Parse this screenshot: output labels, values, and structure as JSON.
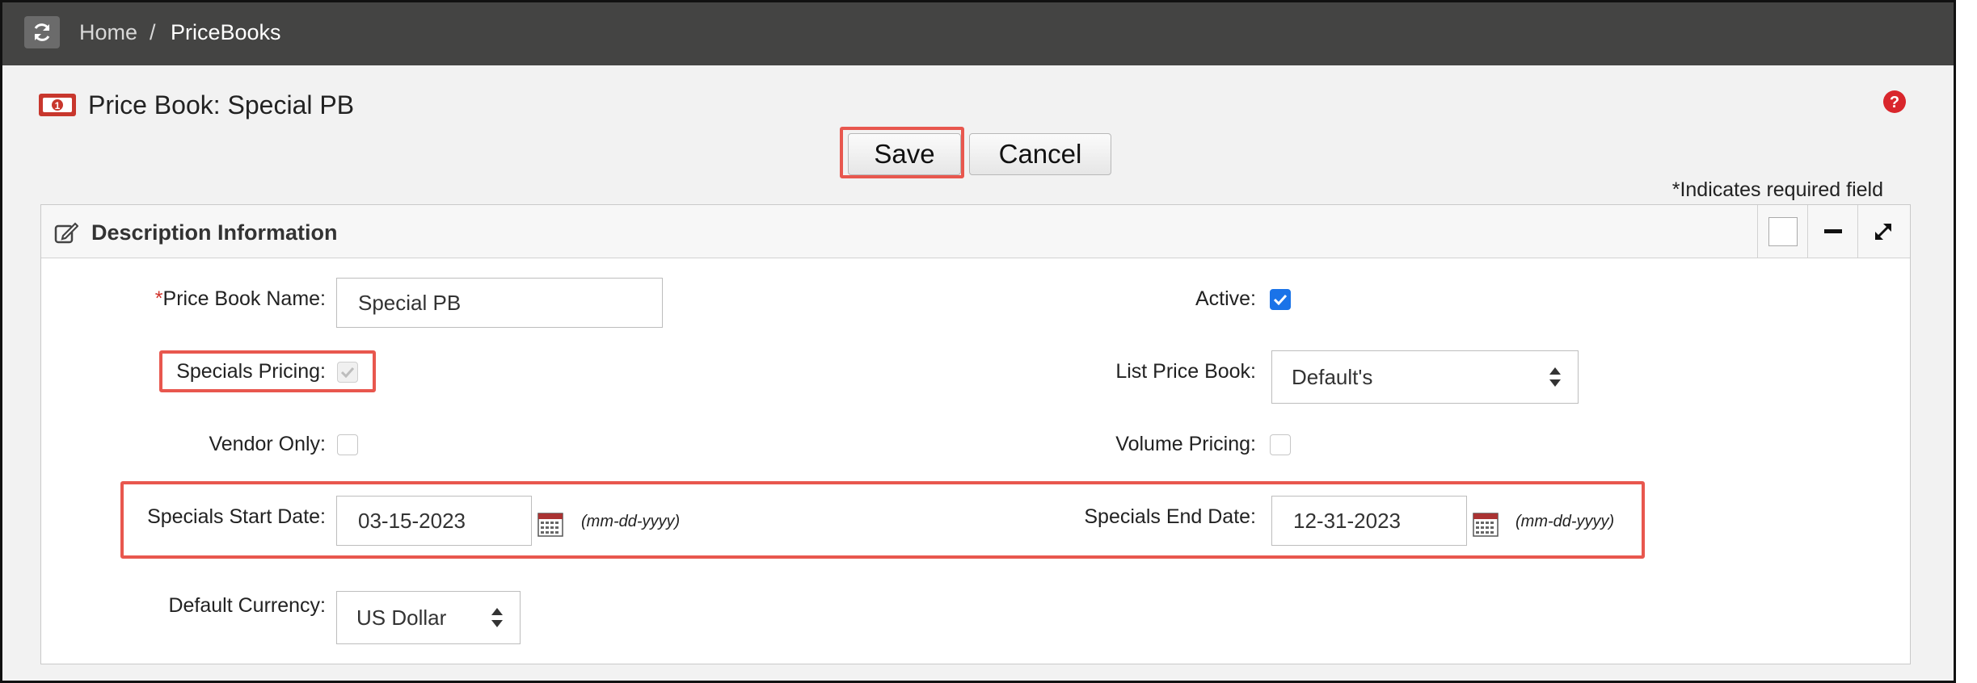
{
  "breadcrumb": {
    "home": "Home",
    "separator": "/",
    "current": "PriceBooks"
  },
  "page": {
    "title": "Price Book: Special PB"
  },
  "toolbar": {
    "save_label": "Save",
    "cancel_label": "Cancel"
  },
  "required_note": "*Indicates required field",
  "panel": {
    "title": "Description Information",
    "fields": {
      "price_book_name": {
        "required_mark": "*",
        "label": "Price Book Name:",
        "value": "Special PB"
      },
      "active": {
        "label": "Active:",
        "checked": true
      },
      "specials_pricing": {
        "label": "Specials Pricing:",
        "checked": true,
        "disabled": true
      },
      "list_price_book": {
        "label": "List Price Book:",
        "value": "Default's"
      },
      "vendor_only": {
        "label": "Vendor Only:",
        "checked": false
      },
      "volume_pricing": {
        "label": "Volume Pricing:",
        "checked": false
      },
      "specials_start_date": {
        "label": "Specials Start Date:",
        "value": "03-15-2023",
        "format_hint": "(mm-dd-yyyy)"
      },
      "specials_end_date": {
        "label": "Specials End Date:",
        "value": "12-31-2023",
        "format_hint": "(mm-dd-yyyy)"
      },
      "default_currency": {
        "label": "Default Currency:",
        "value": "US Dollar"
      }
    }
  },
  "icons": {
    "refresh": "refresh-icon",
    "price_book": "money-bill-icon",
    "help": "help-icon",
    "edit": "edit-icon",
    "calendar": "calendar-icon",
    "minimize": "minus-icon",
    "expand": "expand-icon"
  },
  "colors": {
    "topbar": "#444443",
    "highlight": "#e8574e",
    "checkbox_active": "#1a73e8",
    "help": "#d9262c"
  }
}
